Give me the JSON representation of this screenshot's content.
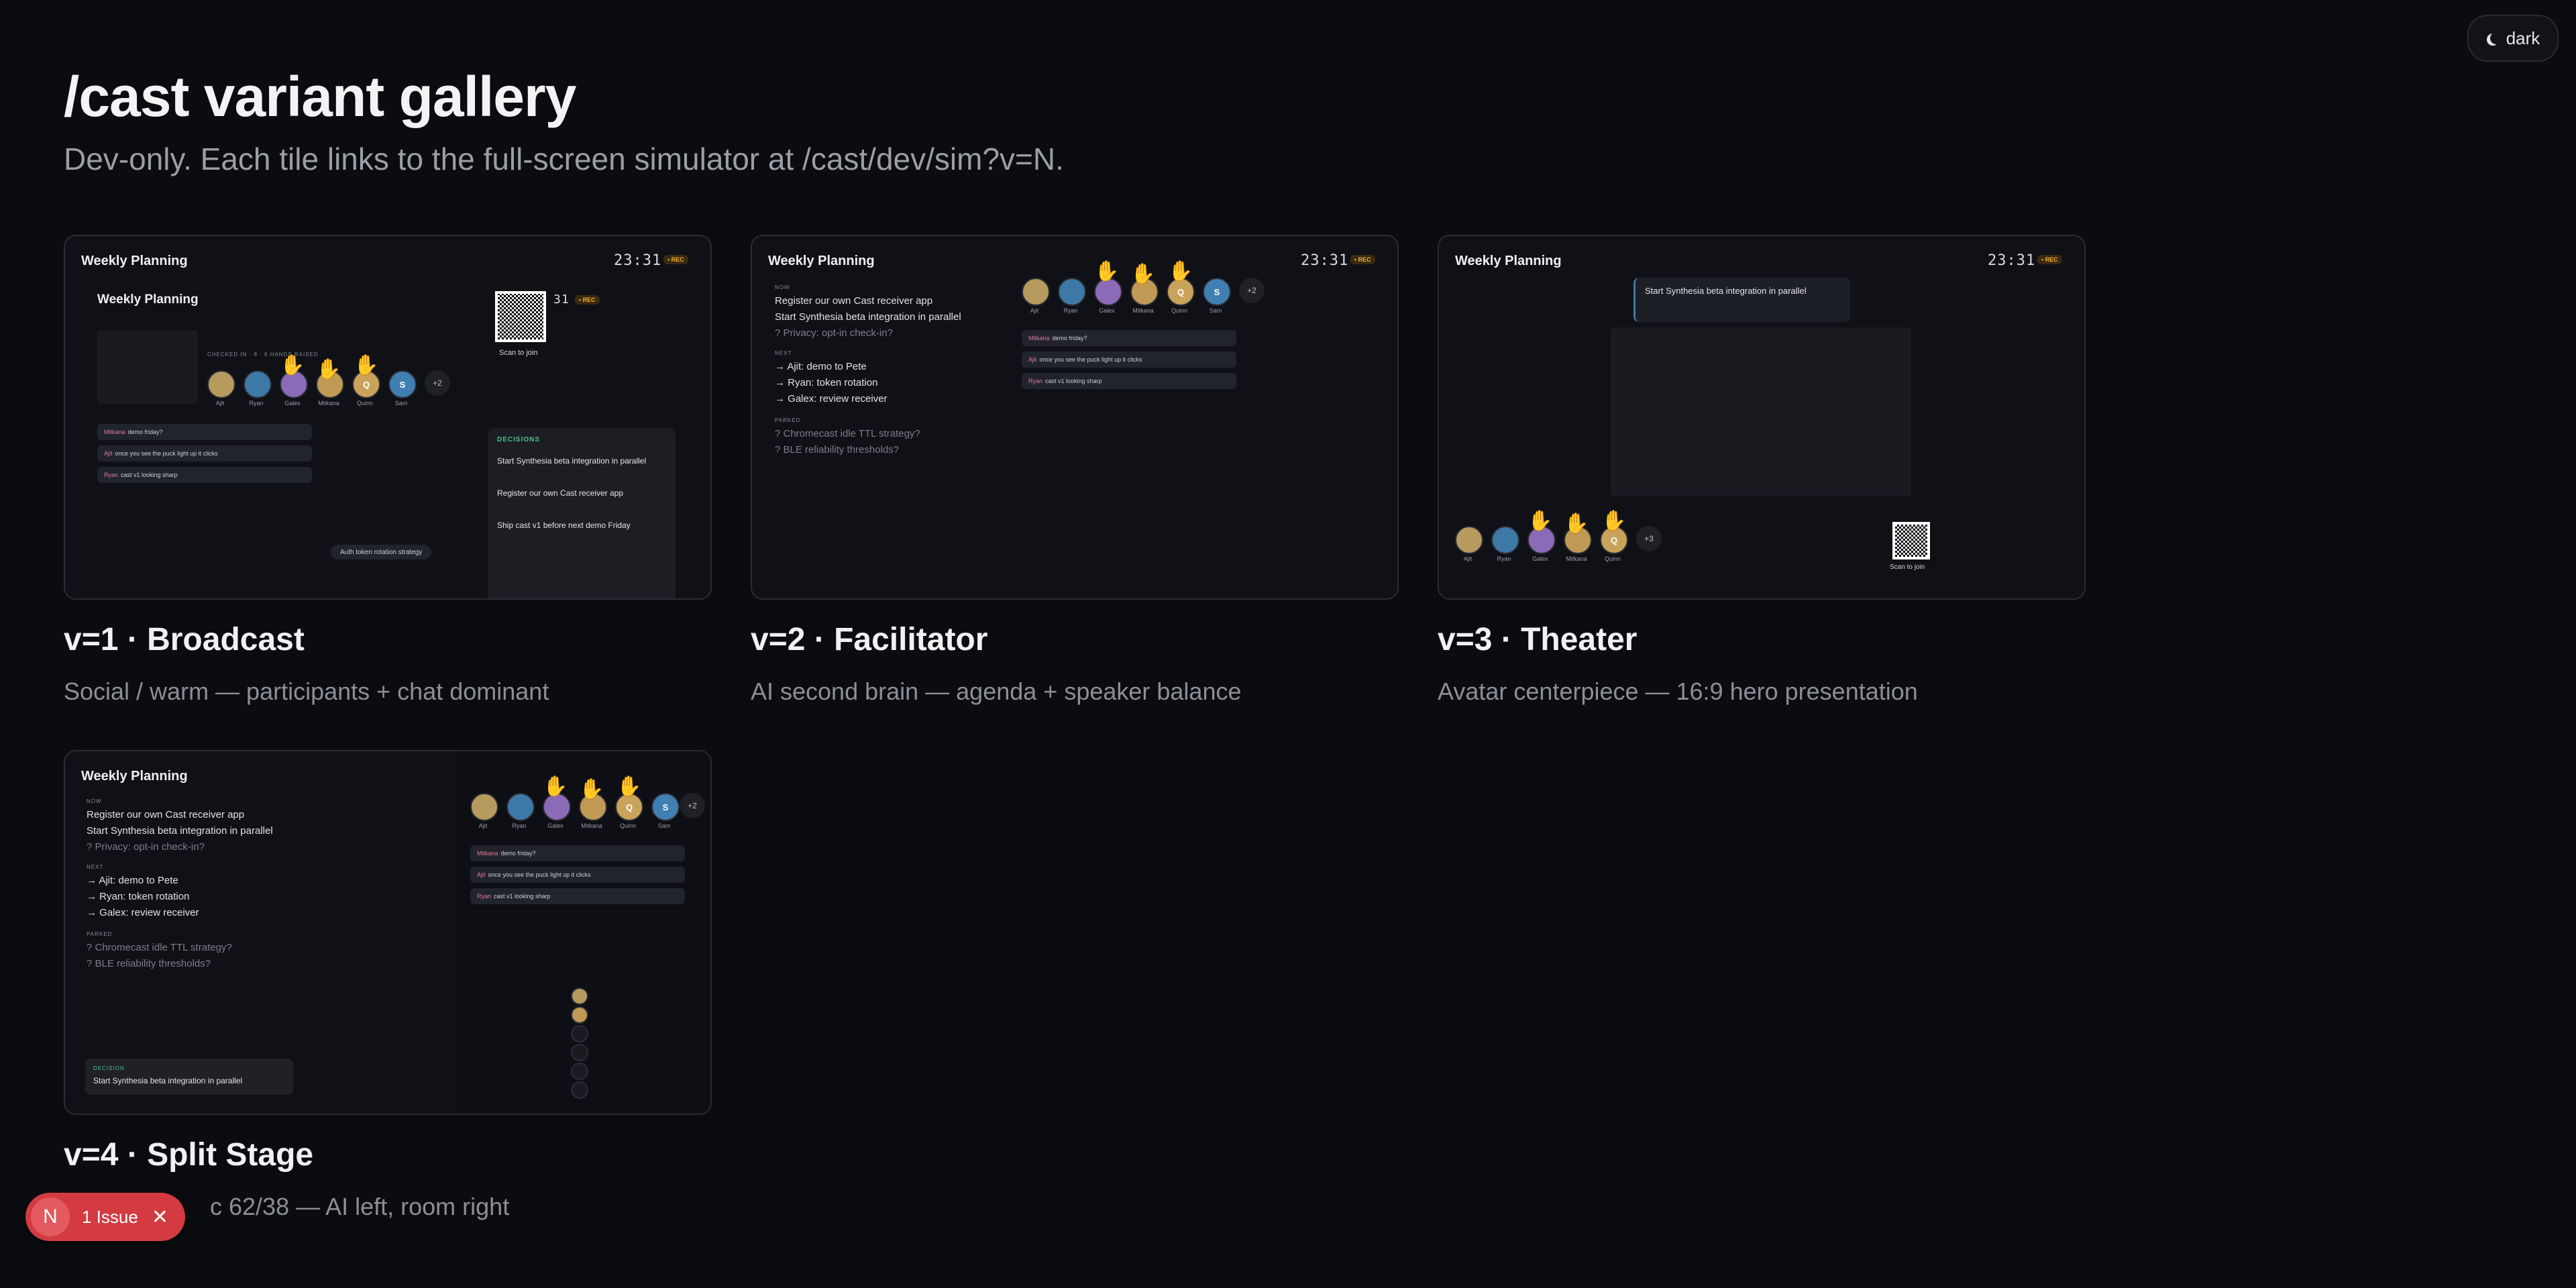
{
  "header": {
    "title": "/cast variant gallery",
    "subtitle": "Dev-only. Each tile links to the full-screen simulator at /cast/dev/sim?v=N.",
    "theme_toggle": "dark"
  },
  "common": {
    "meeting_title": "Weekly Planning",
    "clock": "23:31",
    "rec": "• REC",
    "scan_to_join": "Scan to join",
    "plus_more": "+2",
    "participants": [
      "Ajit",
      "Ryan",
      "Galex",
      "Mitkana",
      "Quinn",
      "Sam"
    ],
    "chat": [
      {
        "who": "Mitkana",
        "text": "demo friday?"
      },
      {
        "who": "Ajit",
        "text": "once you see the puck light up it clicks"
      },
      {
        "who": "Ryan",
        "text": "cast v1 looking sharp"
      }
    ],
    "agenda": {
      "now_label": "NOW",
      "now": [
        "Register our own Cast receiver app",
        "Start Synthesia beta integration in parallel",
        "? Privacy: opt-in check-in?"
      ],
      "next_label": "NEXT",
      "next": [
        "→ Ajit: demo to Pete",
        "→ Ryan: token rotation",
        "→ Galex: review receiver"
      ],
      "parked_label": "PARKED",
      "parked": [
        "? Chromecast idle TTL strategy?",
        "? BLE reliability thresholds?"
      ]
    }
  },
  "tiles": [
    {
      "title": "v=1 · Broadcast",
      "description": "Social / warm — participants + chat dominant",
      "checked_in": "CHECKED IN · 8 · 6 HANDS RAISED",
      "decisions_label": "DECISIONS",
      "decisions": [
        "Start Synthesia beta integration in parallel",
        "Register our own Cast receiver app",
        "Ship cast v1 before next demo Friday"
      ],
      "ticker": "Auth token rotation strategy"
    },
    {
      "title": "v=2 · Facilitator",
      "description": "AI second brain — agenda + speaker balance"
    },
    {
      "title": "v=3 · Theater",
      "description": "Avatar centerpiece — 16:9 hero presentation",
      "hero_caption": "Start Synthesia beta integration in parallel"
    },
    {
      "title": "v=4 · Split Stage",
      "description": "c 62/38 — AI left, room right",
      "decision_label": "DECISION",
      "decision": "Start Synthesia beta integration in parallel"
    }
  ],
  "issue_badge": {
    "logo": "N",
    "label": "1 Issue"
  },
  "colors": {
    "background": "#0b0c10",
    "accent_red": "#d33b41",
    "rec_gold": "#f2b233"
  }
}
